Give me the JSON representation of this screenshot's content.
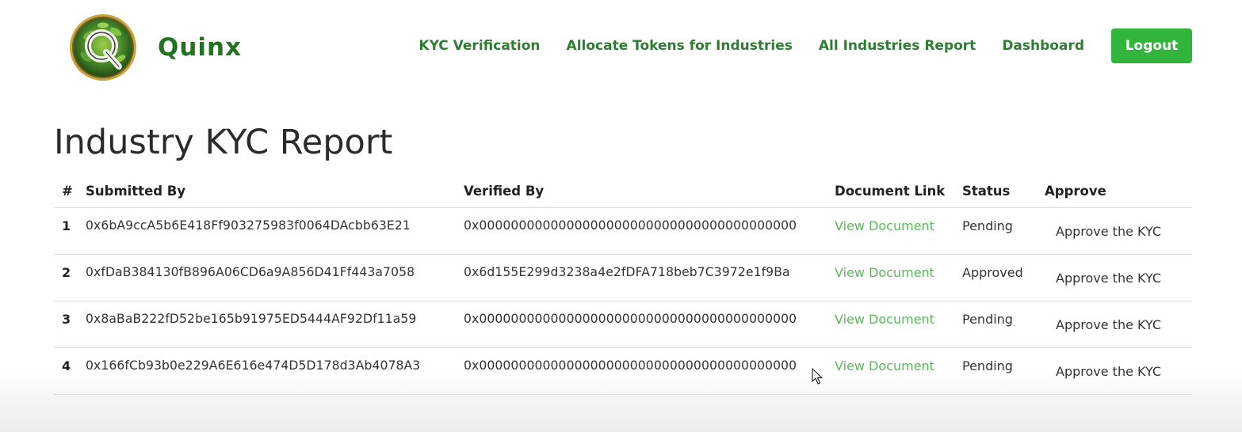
{
  "brand": {
    "name": "Quinx",
    "logo_icon": "quinx-leaf-q-logo",
    "colors": {
      "brand_text": "#23721f",
      "nav_link": "#2e7d32",
      "logout_bg": "#32b53b",
      "doc_link": "#5cb85c"
    }
  },
  "nav": {
    "links": [
      {
        "label": "KYC Verification"
      },
      {
        "label": "Allocate Tokens for Industries"
      },
      {
        "label": "All Industries Report"
      },
      {
        "label": "Dashboard"
      }
    ],
    "logout_label": "Logout"
  },
  "page": {
    "title": "Industry KYC Report"
  },
  "table": {
    "headers": {
      "num": "#",
      "submitted_by": "Submitted By",
      "verified_by": "Verified By",
      "document_link": "Document Link",
      "status": "Status",
      "approve": "Approve"
    },
    "rows": [
      {
        "num": "1",
        "submitted_by": "0x6bA9ccA5b6E418Ff903275983f0064DAcbb63E21",
        "verified_by": "0x0000000000000000000000000000000000000000",
        "document_link": "View Document",
        "status": "Pending",
        "approve": "Approve the KYC"
      },
      {
        "num": "2",
        "submitted_by": "0xfDaB384130fB896A06CD6a9A856D41Ff443a7058",
        "verified_by": "0x6d155E299d3238a4e2fDFA718beb7C3972e1f9Ba",
        "document_link": "View Document",
        "status": "Approved",
        "approve": "Approve the KYC"
      },
      {
        "num": "3",
        "submitted_by": "0x8aBaB222fD52be165b91975ED5444AF92Df11a59",
        "verified_by": "0x0000000000000000000000000000000000000000",
        "document_link": "View Document",
        "status": "Pending",
        "approve": "Approve the KYC"
      },
      {
        "num": "4",
        "submitted_by": "0x166fCb93b0e229A6E616e474D5D178d3Ab4078A3",
        "verified_by": "0x0000000000000000000000000000000000000000",
        "document_link": "View Document",
        "status": "Pending",
        "approve": "Approve the KYC"
      }
    ]
  }
}
